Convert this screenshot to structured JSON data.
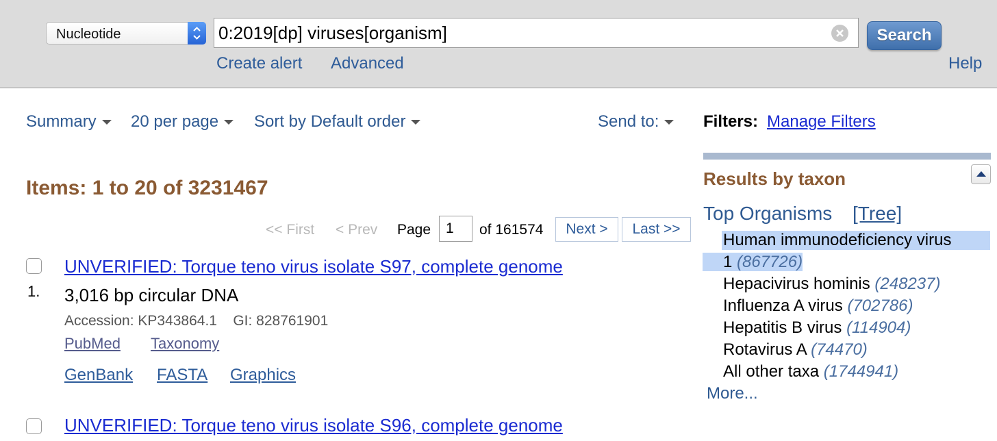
{
  "search": {
    "database": "Nucleotide",
    "query": "0:2019[dp] viruses[organism]",
    "clear_glyph": "⊗",
    "button_label": "Search",
    "create_alert": "Create alert",
    "advanced": "Advanced",
    "help": "Help"
  },
  "toolbar": {
    "format": "Summary",
    "per_page": "20 per page",
    "sort": "Sort by Default order",
    "send_to": "Send to:"
  },
  "results": {
    "items_label": "Items: 1 to 20 of 3231467"
  },
  "pager": {
    "first": "<< First",
    "prev": "< Prev",
    "page_label": "Page",
    "page_value": "1",
    "of_label": "of 161574",
    "next": "Next >",
    "last": "Last >>"
  },
  "docsums": [
    {
      "number": "1.",
      "title": "UNVERIFIED: Torque teno virus isolate S97, complete genome",
      "desc": "3,016 bp circular DNA",
      "meta": "Accession: KP343864.1    GI: 828761901",
      "links": [
        "PubMed",
        "Taxonomy"
      ],
      "links2": [
        "GenBank",
        "FASTA",
        "Graphics"
      ]
    },
    {
      "title": "UNVERIFIED: Torque teno virus isolate S96, complete genome"
    }
  ],
  "sidebar": {
    "filters_label": "Filters:",
    "manage_filters": "Manage Filters",
    "taxon_title": "Results by taxon",
    "top_organisms": "Top Organisms",
    "tree": "[Tree]",
    "organisms": [
      {
        "name_line1": "Human immunodeficiency virus",
        "name_line2": "1",
        "count": "(867726)"
      },
      {
        "name": "Hepacivirus hominis",
        "count": "(248237)"
      },
      {
        "name": "Influenza A virus",
        "count": "(702786)"
      },
      {
        "name": "Hepatitis B virus",
        "count": "(114904)"
      },
      {
        "name": "Rotavirus A",
        "count": "(74470)"
      },
      {
        "name": "All other taxa",
        "count": "(1744941)"
      }
    ],
    "more": "More..."
  }
}
